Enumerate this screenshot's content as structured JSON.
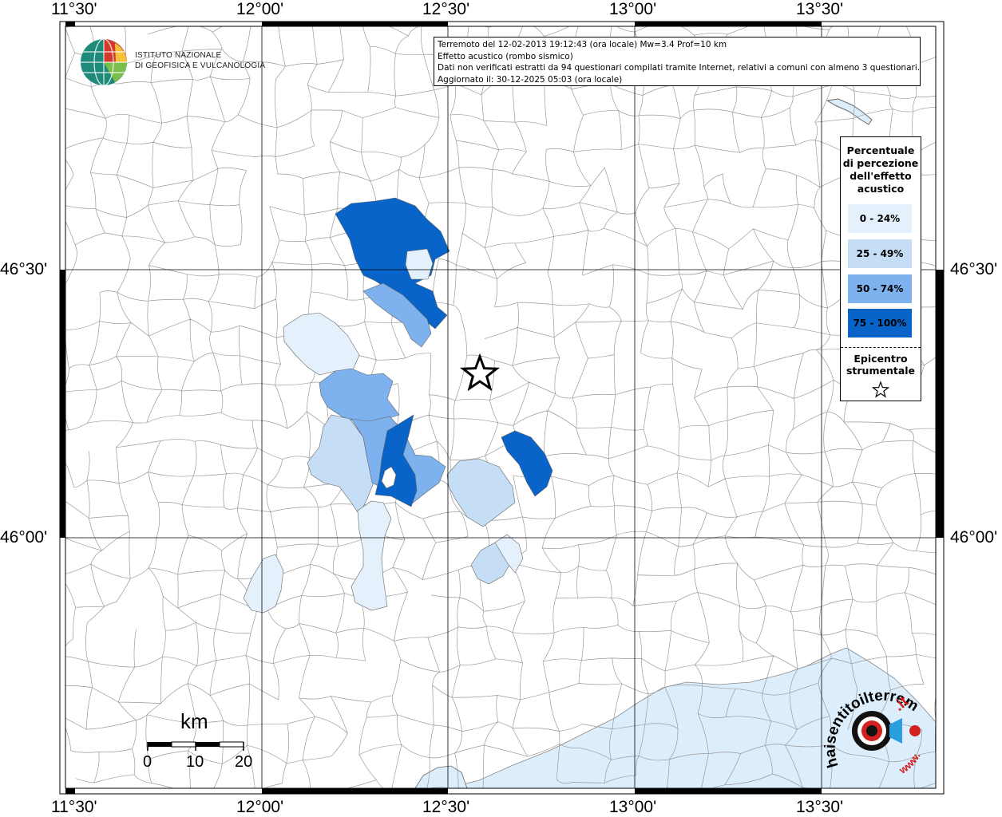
{
  "info": {
    "line1": "Terremoto del 12-02-2013 19:12:43 (ora locale) Mw=3.4 Prof=10 km",
    "line2": "Effetto acustico (rombo sismico)",
    "line3": "Dati non verificati estratti da 94 questionari compilati tramite Internet, relativi a comuni con almeno 3 questionari.",
    "line4": "Aggiornato il: 30-12-2025 05:03 (ora locale)"
  },
  "axes": {
    "lon_ticks": [
      "11°30'",
      "12°00'",
      "12°30'",
      "13°00'",
      "13°30'"
    ],
    "lat_ticks": [
      "46°30'",
      "46°00'"
    ]
  },
  "legend": {
    "title": "Percentuale di percezione dell'effetto acustico",
    "classes": [
      {
        "label": "0 - 24%",
        "color": "#e4f1fc"
      },
      {
        "label": "25 - 49%",
        "color": "#c6ddf6"
      },
      {
        "label": "50 - 74%",
        "color": "#7eb2ee"
      },
      {
        "label": "75 - 100%",
        "color": "#0864c8"
      }
    ],
    "epicenter_label": "Epicentro strumentale"
  },
  "logo": {
    "line1": "ISTITUTO NAZIONALE",
    "line2": "DI GEOFISICA E VULCANOLOGIA"
  },
  "scale": {
    "unit": "km",
    "labels": [
      "0",
      "10",
      "20"
    ]
  },
  "site_logo": {
    "text_main": "haisentitoilterremoto",
    "text_tld": ".it",
    "text_www": "www."
  },
  "colors": {
    "sea": "#dcedfb",
    "boundary": "#9a9a9a"
  },
  "icons": {
    "epicenter": "star-icon"
  }
}
